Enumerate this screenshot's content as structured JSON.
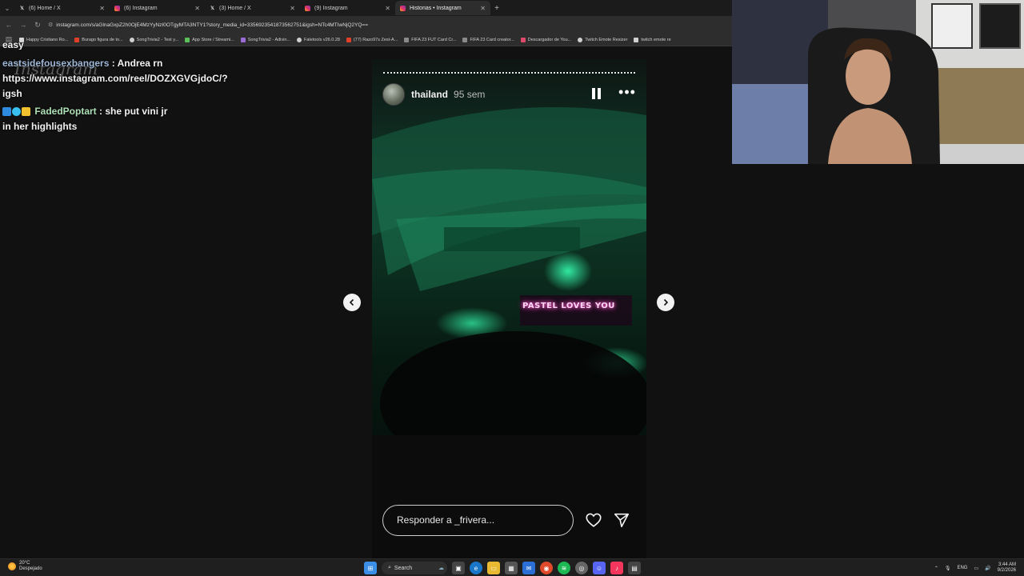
{
  "browser": {
    "tabs": [
      {
        "label": "(6) Home / X",
        "icon": "x-icon",
        "active": false
      },
      {
        "label": "(6) Instagram",
        "icon": "instagram-icon",
        "active": false
      },
      {
        "label": "(3) Home / X",
        "icon": "x-icon",
        "active": false
      },
      {
        "label": "(9) Instagram",
        "icon": "instagram-icon",
        "active": false
      },
      {
        "label": "Historias • Instagram",
        "icon": "instagram-icon",
        "active": true
      }
    ],
    "url": "instagram.com/s/aGlnaGxpZ2h0OjE4MzYyNzI0OTgyMTA3NTY1?story_media_id=3356923541873562751&igsh=NTc4MTIwNjQ2YQ==",
    "bookmarks": [
      "Happy Cristiano Ro...",
      "Burago figura de to...",
      "SongTrivia2 - Test y...",
      "App Store / Streami...",
      "SongTrivia2 - Adivin...",
      "Faletools v26.0.28",
      "(77) Razo97s Zest-A...",
      "FIFA 23 FUT Card Cr...",
      "FIFA 23 Card creator...",
      "Descargador de You...",
      "Twitch Emote Resizer",
      "twitch emote re"
    ]
  },
  "chat": {
    "watermark": "Instagram",
    "top_partial": "easy",
    "messages": [
      {
        "user": "eastsidefousexbangers",
        "text": ": Andrea rn https://www.instagram.com/reel/DOZXGVGjdoC/?igsh"
      },
      {
        "user": "FadedPoptart",
        "text": ": she put vini jr in her highlights"
      }
    ]
  },
  "story": {
    "username": "thailand",
    "time": "95 sem",
    "neon_text": "PASTEL LOVES YOU",
    "reply_placeholder": "Responder a _frivera...",
    "progress": 1.0
  },
  "taskbar": {
    "weather_temp": "20°C",
    "weather_desc": "Despejado",
    "search_label": "Search",
    "lang": "ENG",
    "time": "3:44 AM",
    "date": "9/2/2026"
  },
  "colors": {
    "neon_green": "#1fe08a",
    "neon_pink": "#ff5fd0",
    "page_bg": "#111111"
  }
}
